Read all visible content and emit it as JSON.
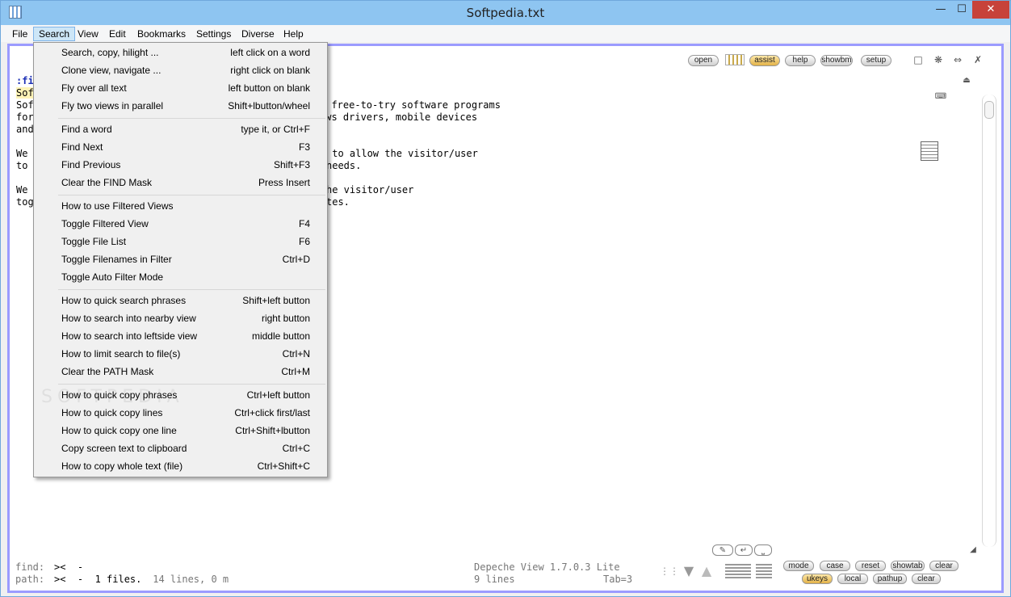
{
  "window": {
    "title": "Softpedia.txt"
  },
  "menubar": [
    "File",
    "Search",
    "View",
    "Edit",
    "Bookmarks",
    "Settings",
    "Diverse",
    "Help"
  ],
  "toolbar": {
    "open": "open",
    "assist": "assist",
    "help": "help",
    "showbm": "showbm",
    "setup": "setup"
  },
  "editor": {
    "line1": ":fi",
    "line2": "Sof",
    "line3a": "Sof",
    "line3b": "d free-to-try software programs",
    "line4a": "for",
    "line4b": "ows drivers, mobile devices",
    "line5a": "and",
    "line6a": "We ",
    "line6b": " to allow the visitor/user",
    "line7a": "to ",
    "line7b": "needs.",
    "line8a": "We ",
    "line8b": "he visitor/user",
    "line9a": "tog",
    "line9b": "tes."
  },
  "search_menu": [
    {
      "label": "Search, copy, hilight ...",
      "key": "left click on a word"
    },
    {
      "label": "Clone view, navigate ...",
      "key": "right click on blank"
    },
    {
      "label": "Fly over all text",
      "key": "left button on blank"
    },
    {
      "label": "Fly two views in parallel",
      "key": "Shift+lbutton/wheel"
    },
    {
      "label": "Find a word",
      "key": "type it, or Ctrl+F"
    },
    {
      "label": "Find Next",
      "key": "F3"
    },
    {
      "label": "Find Previous",
      "key": "Shift+F3"
    },
    {
      "label": "Clear the FIND Mask",
      "key": "Press Insert"
    },
    {
      "label": "How to use Filtered Views",
      "key": ""
    },
    {
      "label": "Toggle Filtered View",
      "key": "F4"
    },
    {
      "label": "Toggle File List",
      "key": "F6"
    },
    {
      "label": "Toggle Filenames in Filter",
      "key": "Ctrl+D"
    },
    {
      "label": "Toggle Auto Filter Mode",
      "key": ""
    },
    {
      "label": "How to quick search phrases",
      "key": "Shift+left button"
    },
    {
      "label": "How to search into nearby view",
      "key": "right button"
    },
    {
      "label": "How to search into leftside view",
      "key": "middle button"
    },
    {
      "label": "How to limit search to file(s)",
      "key": "Ctrl+N"
    },
    {
      "label": "Clear the PATH Mask",
      "key": "Ctrl+M"
    },
    {
      "label": "How to quick copy phrases",
      "key": "Ctrl+left button"
    },
    {
      "label": "How to quick copy lines",
      "key": "Ctrl+click first/last"
    },
    {
      "label": "How to quick copy one line",
      "key": "Ctrl+Shift+lbutton"
    },
    {
      "label": "Copy screen text to clipboard",
      "key": "Ctrl+C"
    },
    {
      "label": "How to copy whole text (file)",
      "key": "Ctrl+Shift+C"
    }
  ],
  "status": {
    "find_label": "find:",
    "find_value": "><  -",
    "path_label": "path:",
    "path_value": "><  -  1 files.",
    "path_extra": " 14 lines, 0 m",
    "app_version": "Depeche View 1.7.0.3 Lite",
    "lines": "9 lines",
    "tab": "Tab=3"
  },
  "bottom_buttons": {
    "mode": "mode",
    "case": "case",
    "reset": "reset",
    "showtab": "showtab",
    "clear1": "clear",
    "ukeys": "ukeys",
    "local": "local",
    "pathup": "pathup",
    "clear2": "clear"
  },
  "watermark": "SOFTPEDIA"
}
